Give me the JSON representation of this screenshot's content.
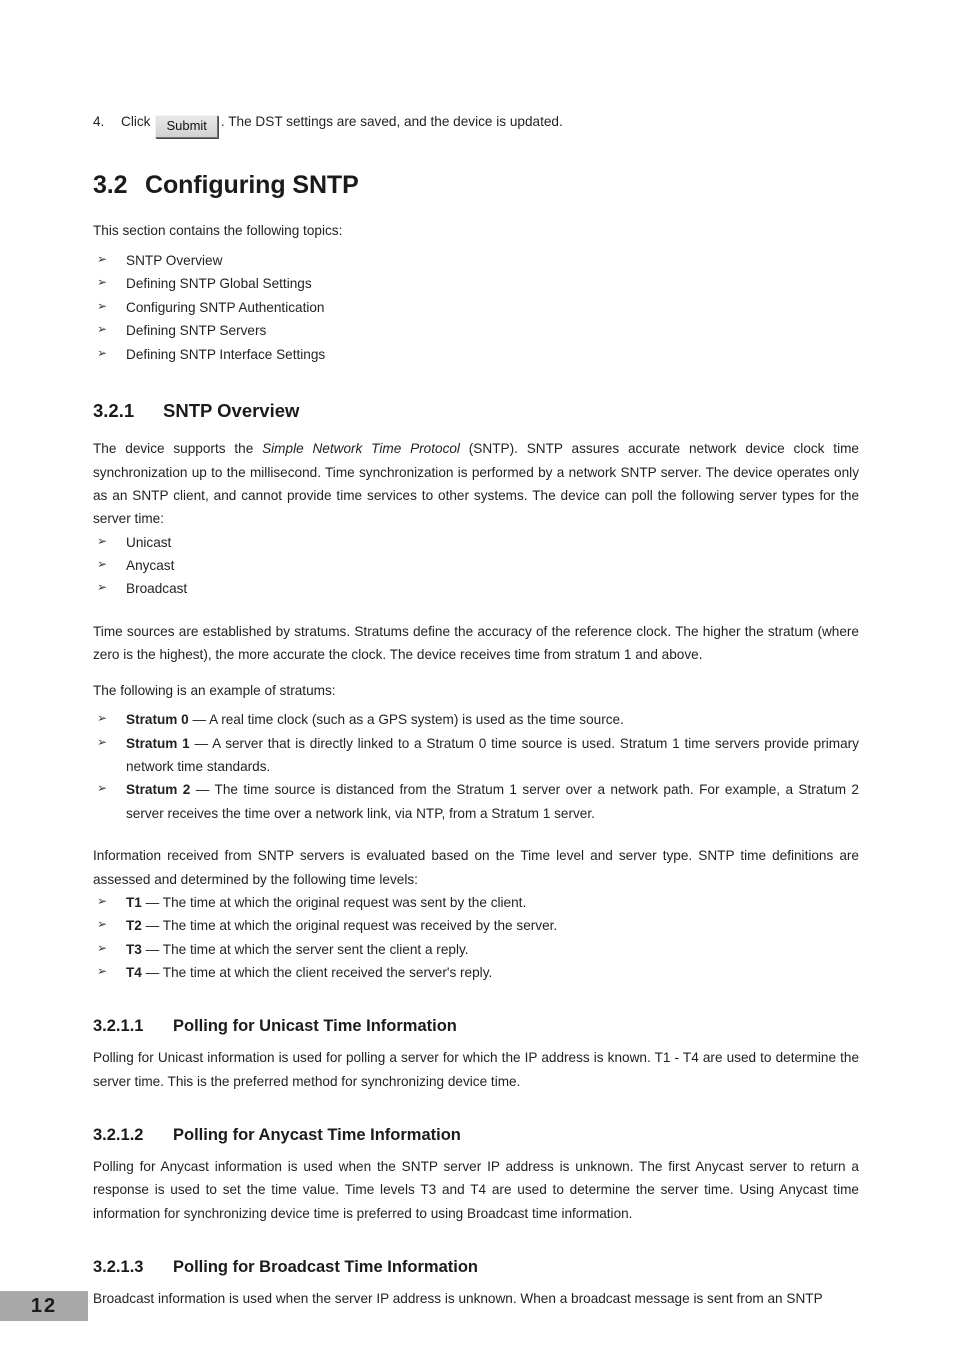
{
  "page": {
    "number": "12"
  },
  "step": {
    "number": "4.",
    "prefix": "Click",
    "button_label": "Submit",
    "suffix": ". The DST settings are saved, and the device is updated."
  },
  "section_32": {
    "number": "3.2",
    "title": "Configuring SNTP",
    "intro": "This section contains the following topics:",
    "topics": [
      "SNTP Overview",
      "Defining SNTP Global Settings",
      "Configuring SNTP Authentication",
      "Defining SNTP Servers",
      "Defining SNTP Interface Settings"
    ]
  },
  "section_321": {
    "number": "3.2.1",
    "title": "SNTP Overview",
    "para1_a": "The device supports the ",
    "para1_italic": "Simple Network Time Protocol",
    "para1_b": " (SNTP). SNTP assures accurate network device clock time synchronization up to the millisecond. Time synchronization is performed by a network SNTP server. The device operates only as an SNTP client, and cannot provide time services to other systems. The device can poll the following server types for the server time:",
    "server_types": [
      "Unicast",
      "Anycast",
      "Broadcast"
    ],
    "para2": "Time sources are established by stratums. Stratums define the accuracy of the reference clock. The higher the stratum (where zero is the highest), the more accurate the clock. The device receives time from stratum 1 and above.",
    "para3": "The following is an example of stratums:",
    "stratums": [
      {
        "term": "Stratum 0",
        "desc": " — A real time clock (such as a GPS system) is used as the time source."
      },
      {
        "term": "Stratum 1",
        "desc": " — A server that is directly linked to a Stratum 0 time source is used. Stratum 1 time servers provide primary network time standards."
      },
      {
        "term": "Stratum 2",
        "desc": " — The time source is distanced from the Stratum 1 server over a network path. For example, a Stratum 2 server receives the time over a network link, via NTP, from a Stratum 1 server."
      }
    ],
    "para4": "Information received from SNTP servers is evaluated based on the Time level and server type. SNTP time definitions are assessed and determined by the following time levels:",
    "time_levels": [
      {
        "term": "T1",
        "desc": " — The time at which the original request was sent by the client."
      },
      {
        "term": "T2",
        "desc": " — The time at which the original request was received by the server."
      },
      {
        "term": "T3",
        "desc": " — The time at which the server sent the client a reply."
      },
      {
        "term": "T4",
        "desc": " — The time at which the client received the server's reply."
      }
    ]
  },
  "section_3211": {
    "number": "3.2.1.1",
    "title": "Polling for Unicast Time Information",
    "body": "Polling for Unicast information is used for polling a server for which the IP address is known. T1 - T4 are used to determine the server time. This is the preferred method for synchronizing device time."
  },
  "section_3212": {
    "number": "3.2.1.2",
    "title": "Polling for Anycast Time Information",
    "body": "Polling for Anycast information is used when the SNTP server IP address is unknown. The first Anycast server to return a response is used to set the time value. Time levels T3 and T4 are used to determine the server time. Using Anycast time information for synchronizing device time is preferred to using Broadcast time information."
  },
  "section_3213": {
    "number": "3.2.1.3",
    "title": "Polling for Broadcast Time Information",
    "body": "Broadcast information is used when the server IP address is unknown. When a broadcast message is sent from an SNTP"
  },
  "icons": {
    "bullet_arrow": "➢"
  },
  "colors": {
    "text": "#231f20",
    "page_number_bg": "#a8a8a8",
    "button_face": "#dcdcdc"
  }
}
